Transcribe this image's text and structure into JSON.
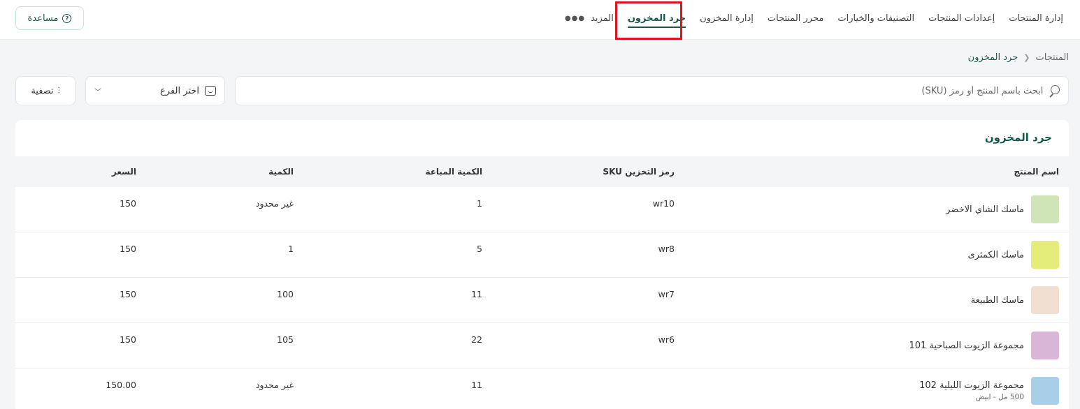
{
  "nav": {
    "tabs": [
      {
        "label": "إدارة المنتجات"
      },
      {
        "label": "إعدادات المنتجات"
      },
      {
        "label": "التصنيفات والخيارات"
      },
      {
        "label": "محرر المنتجات"
      },
      {
        "label": "إدارة المخزون"
      },
      {
        "label": "جرد المخزون",
        "active": true
      }
    ],
    "more_label": "المزيد",
    "help_label": "مساعدة"
  },
  "breadcrumb": {
    "root": "المنتجات",
    "current": "جرد المخزون"
  },
  "filters": {
    "search_placeholder": "ابحث باسم المنتج أو رمز (SKU)",
    "branch_label": "اختر الفرع",
    "filter_label": "تصفية"
  },
  "card": {
    "title": "جرد المخزون",
    "columns": {
      "name": "اسم المنتج",
      "sku": "رمز التخزين SKU",
      "sold": "الكمية المباعة",
      "qty": "الكمية",
      "price": "السعر"
    },
    "rows": [
      {
        "name": "ماسك الشاي الاخضر",
        "sub": "",
        "sku": "wr10",
        "sold": "1",
        "qty": "غير محدود",
        "price": "150",
        "thumb": "#cfe5b8"
      },
      {
        "name": "ماسك الكمثرى",
        "sub": "",
        "sku": "wr8",
        "sold": "5",
        "qty": "1",
        "price": "150",
        "thumb": "#e4ec7a"
      },
      {
        "name": "ماسك الطبيعة",
        "sub": "",
        "sku": "wr7",
        "sold": "11",
        "qty": "100",
        "price": "150",
        "thumb": "#f1e0d2"
      },
      {
        "name": "مجموعة الزيوت الصباحية 101",
        "sub": "",
        "sku": "wr6",
        "sold": "22",
        "qty": "105",
        "price": "150",
        "thumb": "#d9b6d8"
      },
      {
        "name": "مجموعة الزيوت الليلية 102",
        "sub": "500 مل - ابيض",
        "sku": "",
        "sold": "11",
        "qty": "غير محدود",
        "price": "150.00",
        "thumb": "#a9cfe8"
      }
    ]
  }
}
